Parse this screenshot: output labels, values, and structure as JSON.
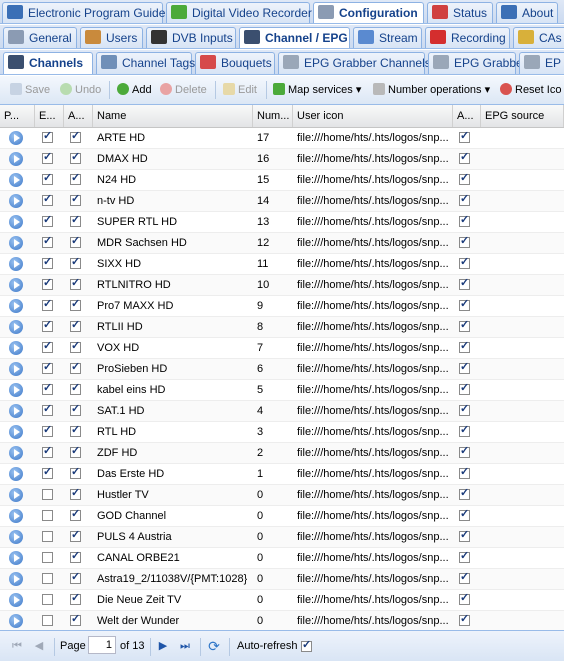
{
  "tabs_top": [
    {
      "label": "Electronic Program Guide",
      "icon": "epg-icon",
      "active": false
    },
    {
      "label": "Digital Video Recorder",
      "icon": "download-icon",
      "active": false
    },
    {
      "label": "Configuration",
      "icon": "wrench-icon",
      "active": true
    },
    {
      "label": "Status",
      "icon": "eye-icon",
      "active": false
    },
    {
      "label": "About",
      "icon": "info-icon",
      "active": false
    }
  ],
  "tabs_second": [
    {
      "label": "General",
      "icon": "wrench-icon",
      "active": false
    },
    {
      "label": "Users",
      "icon": "users-icon",
      "active": false
    },
    {
      "label": "DVB Inputs",
      "icon": "film-icon",
      "active": false
    },
    {
      "label": "Channel / EPG",
      "icon": "tv-icon",
      "active": true
    },
    {
      "label": "Stream",
      "icon": "stream-icon",
      "active": false
    },
    {
      "label": "Recording",
      "icon": "rec-icon",
      "active": false
    },
    {
      "label": "CAs",
      "icon": "key-icon",
      "active": false
    }
  ],
  "tabs_third": [
    {
      "label": "Channels",
      "icon": "tv-icon",
      "active": true
    },
    {
      "label": "Channel Tags",
      "icon": "tag-icon",
      "active": false
    },
    {
      "label": "Bouquets",
      "icon": "grid-icon",
      "active": false
    },
    {
      "label": "EPG Grabber Channels",
      "icon": "puzzle-icon",
      "active": false
    },
    {
      "label": "EPG Grabber",
      "icon": "puzzle-icon",
      "active": false
    },
    {
      "label": "EP",
      "icon": "puzzle-icon",
      "active": false
    }
  ],
  "toolbar": {
    "save": "Save",
    "undo": "Undo",
    "add": "Add",
    "delete": "Delete",
    "edit": "Edit",
    "map_services": "Map services",
    "number_operations": "Number operations",
    "reset_icons": "Reset Ico"
  },
  "columns": [
    "P...",
    "E...",
    "A...",
    "Name",
    "Num...",
    "User icon",
    "A...",
    "EPG source"
  ],
  "rows": [
    {
      "enabled": true,
      "auto": true,
      "name": "ARTE HD",
      "number": "17",
      "icon": "file:///home/hts/.hts/logos/snp...",
      "auto2": true
    },
    {
      "enabled": true,
      "auto": true,
      "name": "DMAX HD",
      "number": "16",
      "icon": "file:///home/hts/.hts/logos/snp...",
      "auto2": true
    },
    {
      "enabled": true,
      "auto": true,
      "name": "N24 HD",
      "number": "15",
      "icon": "file:///home/hts/.hts/logos/snp...",
      "auto2": true
    },
    {
      "enabled": true,
      "auto": true,
      "name": "n-tv HD",
      "number": "14",
      "icon": "file:///home/hts/.hts/logos/snp...",
      "auto2": true
    },
    {
      "enabled": true,
      "auto": true,
      "name": "SUPER RTL HD",
      "number": "13",
      "icon": "file:///home/hts/.hts/logos/snp...",
      "auto2": true
    },
    {
      "enabled": true,
      "auto": true,
      "name": "MDR Sachsen HD",
      "number": "12",
      "icon": "file:///home/hts/.hts/logos/snp...",
      "auto2": true
    },
    {
      "enabled": true,
      "auto": true,
      "name": "SIXX HD",
      "number": "11",
      "icon": "file:///home/hts/.hts/logos/snp...",
      "auto2": true
    },
    {
      "enabled": true,
      "auto": true,
      "name": "RTLNITRO HD",
      "number": "10",
      "icon": "file:///home/hts/.hts/logos/snp...",
      "auto2": true
    },
    {
      "enabled": true,
      "auto": true,
      "name": "Pro7 MAXX HD",
      "number": "9",
      "icon": "file:///home/hts/.hts/logos/snp...",
      "auto2": true
    },
    {
      "enabled": true,
      "auto": true,
      "name": "RTLII HD",
      "number": "8",
      "icon": "file:///home/hts/.hts/logos/snp...",
      "auto2": true
    },
    {
      "enabled": true,
      "auto": true,
      "name": "VOX HD",
      "number": "7",
      "icon": "file:///home/hts/.hts/logos/snp...",
      "auto2": true
    },
    {
      "enabled": true,
      "auto": true,
      "name": "ProSieben HD",
      "number": "6",
      "icon": "file:///home/hts/.hts/logos/snp...",
      "auto2": true
    },
    {
      "enabled": true,
      "auto": true,
      "name": "kabel eins HD",
      "number": "5",
      "icon": "file:///home/hts/.hts/logos/snp...",
      "auto2": true
    },
    {
      "enabled": true,
      "auto": true,
      "name": "SAT.1 HD",
      "number": "4",
      "icon": "file:///home/hts/.hts/logos/snp...",
      "auto2": true
    },
    {
      "enabled": true,
      "auto": true,
      "name": "RTL HD",
      "number": "3",
      "icon": "file:///home/hts/.hts/logos/snp...",
      "auto2": true
    },
    {
      "enabled": true,
      "auto": true,
      "name": "ZDF HD",
      "number": "2",
      "icon": "file:///home/hts/.hts/logos/snp...",
      "auto2": true
    },
    {
      "enabled": true,
      "auto": true,
      "name": "Das Erste HD",
      "number": "1",
      "icon": "file:///home/hts/.hts/logos/snp...",
      "auto2": true
    },
    {
      "enabled": false,
      "auto": true,
      "name": "Hustler TV",
      "number": "0",
      "icon": "file:///home/hts/.hts/logos/snp...",
      "auto2": true
    },
    {
      "enabled": false,
      "auto": true,
      "name": "GOD Channel",
      "number": "0",
      "icon": "file:///home/hts/.hts/logos/snp...",
      "auto2": true
    },
    {
      "enabled": false,
      "auto": true,
      "name": "PULS 4 Austria",
      "number": "0",
      "icon": "file:///home/hts/.hts/logos/snp...",
      "auto2": true
    },
    {
      "enabled": false,
      "auto": true,
      "name": "CANAL ORBE21",
      "number": "0",
      "icon": "file:///home/hts/.hts/logos/snp...",
      "auto2": true
    },
    {
      "enabled": false,
      "auto": true,
      "name": "Astra19_2/11038V/{PMT:1028}",
      "number": "0",
      "icon": "file:///home/hts/.hts/logos/snp...",
      "auto2": true
    },
    {
      "enabled": false,
      "auto": true,
      "name": "Die Neue Zeit TV",
      "number": "0",
      "icon": "file:///home/hts/.hts/logos/snp...",
      "auto2": true
    },
    {
      "enabled": false,
      "auto": true,
      "name": "Welt der Wunder",
      "number": "0",
      "icon": "file:///home/hts/.hts/logos/snp...",
      "auto2": true
    }
  ],
  "pager": {
    "page_label": "Page",
    "page_value": "1",
    "of_label": "of 13",
    "auto_refresh_label": "Auto-refresh",
    "auto_refresh": true
  },
  "colors": {
    "accent": "#15428b",
    "border": "#99bbe8",
    "checked": "#1a3a7a"
  }
}
